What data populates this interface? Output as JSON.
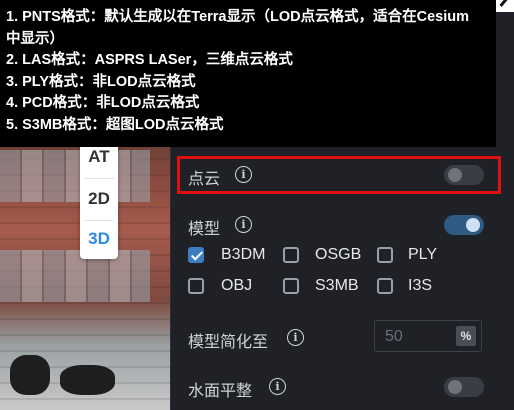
{
  "tooltip": {
    "lines": [
      "1. PNTS格式：默认生成以在Terra显示（LOD点云格式，适合在Cesium",
      "中显示）",
      "2. LAS格式：ASPRS LASer，三维点云格式",
      "3. PLY格式：非LOD点云格式",
      "4. PCD格式：非LOD点云格式",
      "5. S3MB格式：超图LOD点云格式"
    ]
  },
  "view_switch": {
    "items": [
      "AT",
      "2D",
      "3D"
    ],
    "active": "3D"
  },
  "panel": {
    "point_cloud": {
      "label": "点云",
      "enabled": false
    },
    "model": {
      "label": "模型",
      "enabled": true,
      "formats": [
        {
          "label": "B3DM",
          "checked": true
        },
        {
          "label": "OSGB",
          "checked": false
        },
        {
          "label": "PLY",
          "checked": false
        },
        {
          "label": "OBJ",
          "checked": false
        },
        {
          "label": "S3MB",
          "checked": false
        },
        {
          "label": "I3S",
          "checked": false
        }
      ]
    },
    "simplify": {
      "label": "模型简化至",
      "value": "50",
      "unit": "%"
    },
    "water_flatten": {
      "label": "水面平整",
      "enabled": false
    }
  },
  "colors": {
    "accent": "#2f8be6",
    "highlight_box": "#e01010",
    "panel_bg": "#1f2126",
    "toggle_on": "#2d5b84"
  },
  "icons": [
    "info-icon",
    "check-icon"
  ]
}
